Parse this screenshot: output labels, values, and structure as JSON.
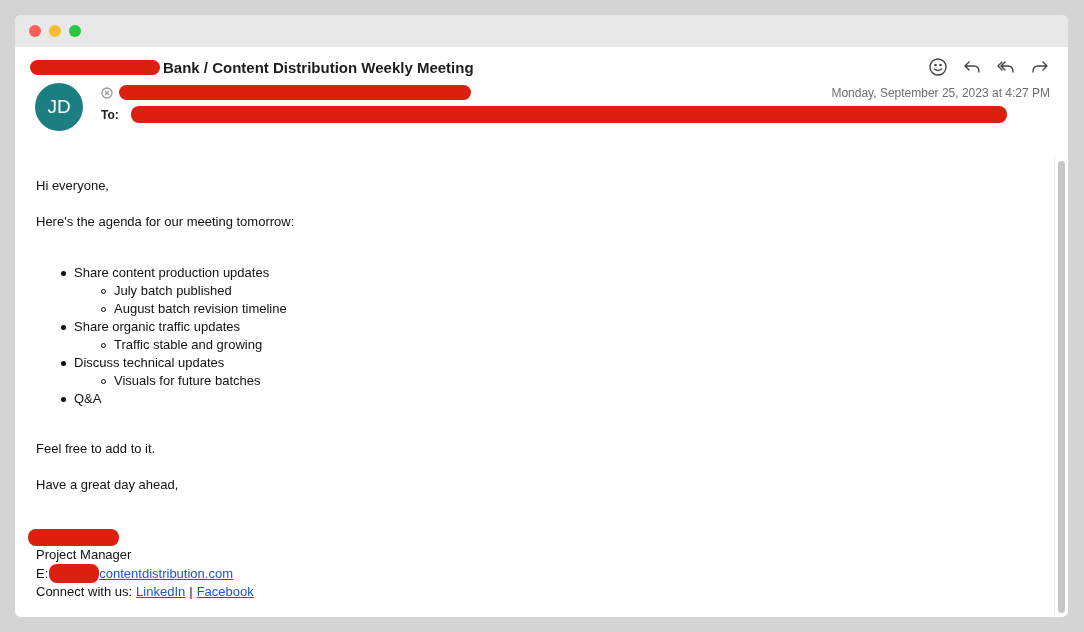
{
  "message": {
    "subject": "Bank / Content Distribution Weekly Meeting",
    "avatar_initials": "JD",
    "to_label": "To:",
    "date": "Monday, September 25, 2023 at 4:27 PM"
  },
  "body": {
    "greeting": "Hi everyone,",
    "intro": "Here's the agenda for our meeting tomorrow:",
    "agenda": [
      {
        "text": "Share content production updates",
        "children": [
          {
            "text": "July batch published"
          },
          {
            "text": "August batch revision timeline"
          }
        ]
      },
      {
        "text": "Share organic traffic updates",
        "children": [
          {
            "text": "Traffic stable and growing"
          }
        ]
      },
      {
        "text": "Discuss technical updates",
        "children": [
          {
            "text": "Visuals for future batches"
          }
        ]
      },
      {
        "text": "Q&A"
      }
    ],
    "closing": [
      "Feel free to add to it.",
      "Have a great day ahead,"
    ]
  },
  "signature": {
    "title": "Project Manager",
    "email_label": "E:",
    "email_link": "contentdistribution.com",
    "connect_label": "Connect with us:",
    "links": [
      "LinkedIn",
      "Facebook"
    ],
    "separator": "|"
  }
}
